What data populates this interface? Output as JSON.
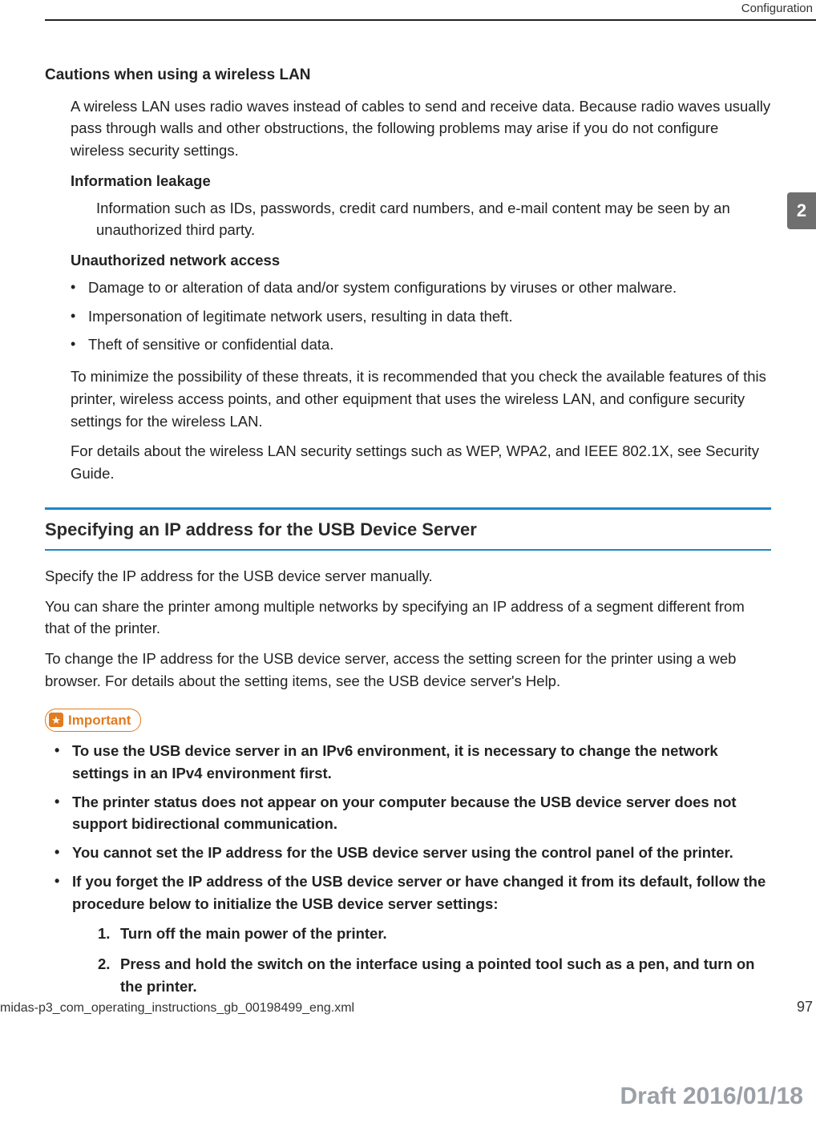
{
  "running_head": "Configuration",
  "chapter_tab": "2",
  "cautions": {
    "heading": "Cautions when using a wireless LAN",
    "intro": "A wireless LAN uses radio waves instead of cables to send and receive data. Because radio waves usually pass through walls and other obstructions, the following problems may arise if you do not configure wireless security settings.",
    "leakage_head": "Information leakage",
    "leakage_body": "Information such as IDs, passwords, credit card numbers, and e-mail content may be seen by an unauthorized third party.",
    "unauth_head": "Unauthorized network access",
    "unauth_items": [
      "Damage to or alteration of data and/or system configurations by viruses or other malware.",
      "Impersonation of legitimate network users, resulting in data theft.",
      "Theft of sensitive or confidential data."
    ],
    "minimize": "To minimize the possibility of these threats, it is recommended that you check the available features of this printer, wireless access points, and other equipment that uses the wireless LAN, and configure security settings for the wireless LAN.",
    "details": "For details about the wireless LAN security settings such as WEP, WPA2, and IEEE 802.1X, see Security Guide."
  },
  "section": {
    "title": "Specifying an IP address for the USB Device Server",
    "p1": "Specify the IP address for the USB device server manually.",
    "p2": "You can share the printer among multiple networks by specifying an IP address of a segment different from that of the printer.",
    "p3": "To change the IP address for the USB device server, access the setting screen for the printer using a web browser. For details about the setting items, see the USB device server's Help.",
    "important_label": "Important",
    "important_items": [
      "To use the USB device server in an IPv6 environment, it is necessary to change the network settings in an IPv4 environment first.",
      "The printer status does not appear on your computer because the USB device server does not support bidirectional communication.",
      "You cannot set the IP address for the USB device server using the control panel of the printer.",
      "If you forget the IP address of the USB device server or have changed it from its default, follow the procedure below to initialize the USB device server settings:"
    ],
    "steps": [
      "Turn off the main power of the printer.",
      "Press and hold the switch on the interface using a pointed tool such as a pen, and turn on the printer."
    ]
  },
  "footer": {
    "file": "midas-p3_com_operating_instructions_gb_00198499_eng.xml",
    "page": "97",
    "draft": "Draft 2016/01/18"
  }
}
